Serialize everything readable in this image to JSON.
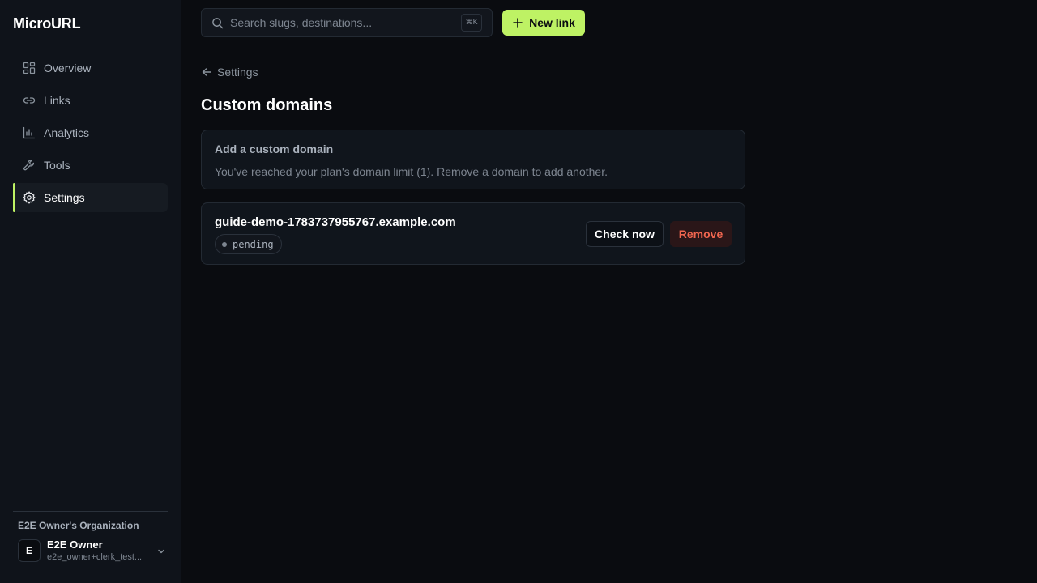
{
  "app": {
    "brand": "MicroURL"
  },
  "sidebar": {
    "items": [
      {
        "label": "Overview",
        "icon": "grid-icon"
      },
      {
        "label": "Links",
        "icon": "link-icon"
      },
      {
        "label": "Analytics",
        "icon": "bar-chart-icon"
      },
      {
        "label": "Tools",
        "icon": "wrench-icon"
      },
      {
        "label": "Settings",
        "icon": "gear-icon",
        "active": true
      }
    ],
    "footer": {
      "org_name": "E2E Owner's Organization",
      "avatar_initial": "E",
      "user_name": "E2E Owner",
      "user_email": "e2e_owner+clerk_test..."
    }
  },
  "topbar": {
    "search_placeholder": "Search slugs, destinations...",
    "shortcut": "⌘K",
    "new_link_label": "New link"
  },
  "main": {
    "back_label": "Settings",
    "title": "Custom domains",
    "add_card": {
      "heading": "Add a custom domain",
      "message": "You've reached your plan's domain limit (1). Remove a domain to add another."
    },
    "domains": [
      {
        "name": "guide-demo-1783737955767.example.com",
        "status": "pending",
        "check_label": "Check now",
        "remove_label": "Remove"
      }
    ]
  },
  "colors": {
    "accent": "#bef264",
    "danger": "#f0664f",
    "background": "#0a0c10",
    "sidebar": "#0f131a"
  }
}
